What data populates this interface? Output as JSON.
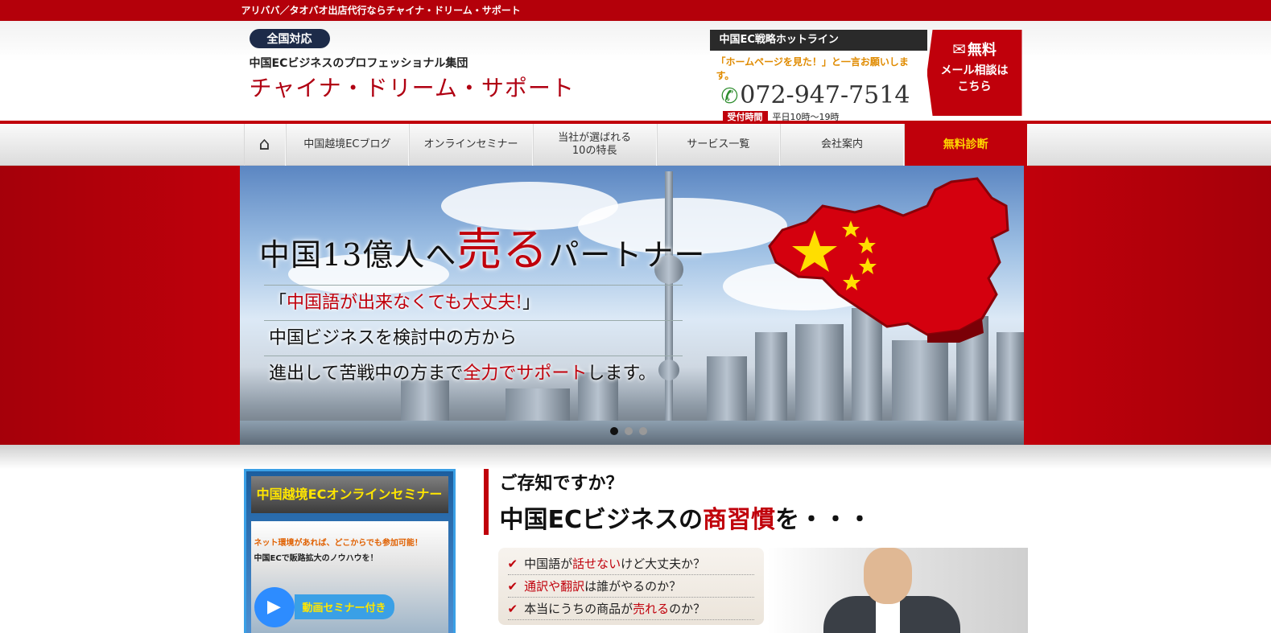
{
  "topbar": {
    "text": "アリババ／タオバオ出店代行ならチャイナ・ドリーム・サポート"
  },
  "header": {
    "badge": "全国対応",
    "tagline": "中国ECビジネスのプロフェッショナル集団",
    "logo": "チャイナ・ドリーム・サポート"
  },
  "hotline": {
    "title": "中国EC戦略ホットライン",
    "note": "「ホームページを見た！」と一言お願いします。",
    "phone": "072-947-7514",
    "hours_label": "受付時間",
    "hours": "平日10時〜19時",
    "mail_line1": "無料",
    "mail_line2": "メール相談は",
    "mail_line3": "こちら"
  },
  "nav": {
    "home_icon": "home-icon",
    "items": [
      "中国越境ECブログ",
      "オンラインセミナー",
      "当社が選ばれる\n10の特長",
      "サービス一覧",
      "会社案内"
    ],
    "cta": "無料診断"
  },
  "hero": {
    "title_a": "中国13億人へ",
    "title_b": "売る",
    "title_c": "パートナー",
    "line1_a": "「",
    "line1_b": "中国語が出来なくても大丈夫!",
    "line1_c": "」",
    "line2": "中国ビジネスを検討中の方から",
    "line3_a": "進出して苦戦中の方まで",
    "line3_b": "全力でサポート",
    "line3_c": "します。",
    "slides": 3,
    "active_slide": 1
  },
  "seminar": {
    "title": "中国越境ECオンラインセミナー",
    "text1": "ネット環境があれば、どこからでも参加可能！",
    "text2": "中国ECで販路拡大のノウハウを！",
    "video": "動画セミナー付き"
  },
  "question": {
    "sub": "ご存知ですか？",
    "main_a": "中国ECビジネスの",
    "main_b": "商習慣",
    "main_c": "を・・・"
  },
  "checklist": [
    {
      "a": "中国語が",
      "b": "話せない",
      "c": "けど大丈夫か？"
    },
    {
      "a": "",
      "b": "通訳や翻訳",
      "c": "は誰がやるのか？"
    },
    {
      "a": "本当にうちの商品が",
      "b": "売れる",
      "c": "のか？"
    }
  ],
  "colors": {
    "brand_red": "#c0000b",
    "nav_cta_text": "#ffd600",
    "dark": "#1d2b49"
  }
}
